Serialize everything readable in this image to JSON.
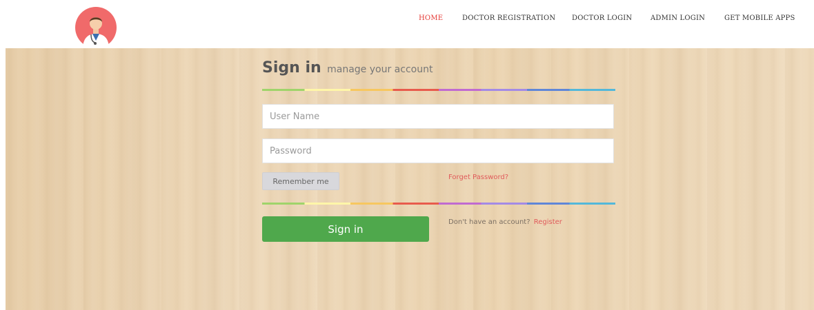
{
  "nav": {
    "home": "HOME",
    "doctor_registration": "DOCTOR REGISTRATION",
    "doctor_login": "DOCTOR LOGIN",
    "admin_login": "ADMIN LOGIN",
    "get_mobile_apps": "GET MOBILE APPS",
    "active_item": "HOME"
  },
  "logo": {
    "icon": "doctor-avatar-icon"
  },
  "login": {
    "title": "Sign in",
    "subtitle": "manage your account",
    "username_placeholder": "User Name",
    "username_value": "",
    "password_placeholder": "Password",
    "password_value": "",
    "remember_label": "Remember me",
    "forget_label": "Forget Password?",
    "signin_label": "Sign in",
    "no_account_text": "Don't have an account?",
    "register_label": "Register"
  },
  "colors": {
    "accent_active": "#e53935",
    "signin_button": "#4fa84c",
    "link_red": "#e05a5a",
    "wood_background": "#ecd5b3",
    "rainbow": [
      "#9fd46a",
      "#fff6a8",
      "#f7c75f",
      "#e85b4c",
      "#c06ad1",
      "#a38ae6",
      "#5f86d8",
      "#53b8da"
    ]
  }
}
